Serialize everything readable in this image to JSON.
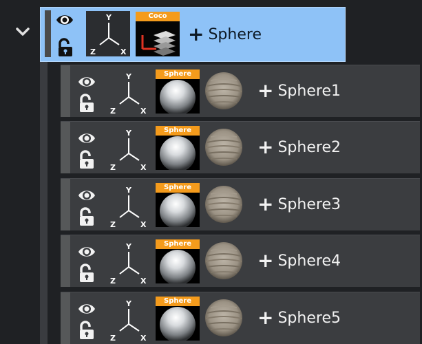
{
  "parent": {
    "name": "Sphere",
    "badge": "Coco",
    "axes": {
      "x": "X",
      "y": "Y",
      "z": "Z"
    }
  },
  "children": [
    {
      "name": "Sphere1",
      "badge": "Sphere"
    },
    {
      "name": "Sphere2",
      "badge": "Sphere"
    },
    {
      "name": "Sphere3",
      "badge": "Sphere"
    },
    {
      "name": "Sphere4",
      "badge": "Sphere"
    },
    {
      "name": "Sphere5",
      "badge": "Sphere"
    }
  ],
  "axes_labels": {
    "x": "X",
    "y": "Y",
    "z": "Z"
  },
  "plus_symbol": "+",
  "colors": {
    "selected_bg": "#8ec2f7",
    "row_bg": "#3b3d40",
    "badge": "#f49b1c",
    "background": "#1f2124"
  },
  "icons": [
    "chevron-down-icon",
    "eye-icon",
    "unlock-icon",
    "axes-icon",
    "sphere-icon",
    "texture-icon",
    "plus-icon"
  ]
}
